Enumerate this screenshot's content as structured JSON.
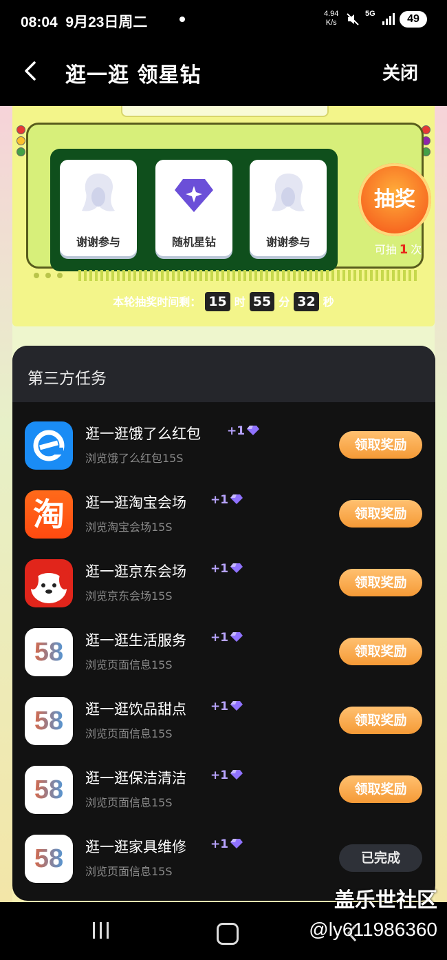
{
  "status_bar": {
    "time": "08:04",
    "date": "9月23日周二",
    "speed_value": "4.94",
    "speed_unit": "K/s",
    "network": "5G",
    "battery": "49"
  },
  "header": {
    "title": "逛一逛 领星钻",
    "close_label": "关闭"
  },
  "lottery": {
    "prizes": [
      {
        "label": "谢谢参与",
        "icon": "thanks-icon"
      },
      {
        "label": "随机星钻",
        "icon": "star-diamond-icon"
      },
      {
        "label": "谢谢参与",
        "icon": "thanks-icon"
      }
    ],
    "draw_button": "抽奖",
    "draw_count_prefix": "可抽",
    "draw_count": "1",
    "draw_count_suffix": "次",
    "timer_label": "本轮抽奖时间剩：",
    "hours": "15",
    "hours_unit": "时",
    "minutes": "55",
    "minutes_unit": "分",
    "seconds": "32",
    "seconds_unit": "秒"
  },
  "tasks": {
    "title": "第三方任务",
    "items": [
      {
        "name": "逛一逛饿了么红包",
        "reward": "+1",
        "sub": "浏览饿了么红包15S",
        "action": "领取奖励",
        "done": false,
        "app": "eleme"
      },
      {
        "name": "逛一逛淘宝会场",
        "reward": "+1",
        "sub": "浏览淘宝会场15S",
        "action": "领取奖励",
        "done": false,
        "app": "taobao"
      },
      {
        "name": "逛一逛京东会场",
        "reward": "+1",
        "sub": "浏览京东会场15S",
        "action": "领取奖励",
        "done": false,
        "app": "jd"
      },
      {
        "name": "逛一逛生活服务",
        "reward": "+1",
        "sub": "浏览页面信息15S",
        "action": "领取奖励",
        "done": false,
        "app": "58"
      },
      {
        "name": "逛一逛饮品甜点",
        "reward": "+1",
        "sub": "浏览页面信息15S",
        "action": "领取奖励",
        "done": false,
        "app": "58"
      },
      {
        "name": "逛一逛保洁清洁",
        "reward": "+1",
        "sub": "浏览页面信息15S",
        "action": "领取奖励",
        "done": false,
        "app": "58"
      },
      {
        "name": "逛一逛家具维修",
        "reward": "+1",
        "sub": "浏览页面信息15S",
        "action": "已完成",
        "done": true,
        "app": "58"
      }
    ]
  },
  "app_icon_text": {
    "taobao": "淘",
    "fifty_eight": "58"
  },
  "watermark": {
    "line1": "盖乐世社区",
    "line2": "@ly611986360"
  },
  "colors": {
    "accent_orange": "#f59a36",
    "draw_red": "#e8271a",
    "panel_dark": "#121212",
    "reward_purple": "#b8a4ff"
  }
}
